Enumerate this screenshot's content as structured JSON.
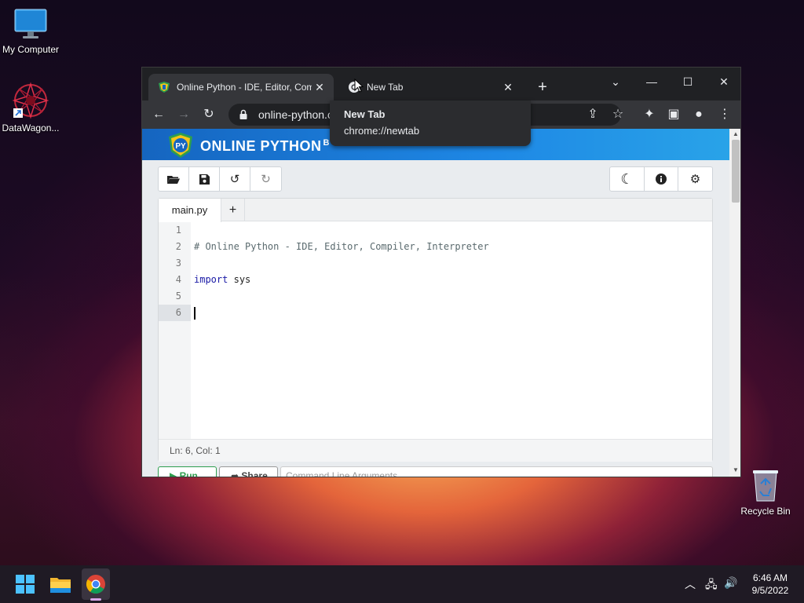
{
  "desktop": {
    "icons": [
      {
        "label": "My Computer"
      },
      {
        "label": "DataWagon..."
      },
      {
        "label": "Recycle Bin"
      }
    ]
  },
  "browser": {
    "tabs": [
      {
        "title": "Online Python - IDE, Editor, Compiler, Interpreter",
        "active": true
      },
      {
        "title": "New Tab",
        "active": false
      }
    ],
    "address": "online-python.com",
    "tooltip": {
      "title": "New Tab",
      "url": "chrome://newtab"
    }
  },
  "site": {
    "title": "ONLINE PYTHON",
    "title_suffix": "B"
  },
  "editor": {
    "file_tabs": [
      {
        "label": "main.py"
      }
    ],
    "add_tab_label": "+",
    "line_numbers": [
      "1",
      "2",
      "3",
      "4",
      "5",
      "6"
    ],
    "comment_line": "# Online Python - IDE, Editor, Compiler, Interpreter",
    "import_keyword": "import",
    "import_module": "sys",
    "status": "Ln: 6,  Col: 1"
  },
  "actions": {
    "run_label": "Run",
    "share_label": "Share",
    "args_placeholder": "Command Line Arguments"
  },
  "taskbar": {
    "time": "6:46 AM",
    "date": "9/5/2022"
  },
  "colors": {
    "accent": "#1e88e5",
    "run": "#2e9e4e",
    "keyword": "#1a1aa6"
  }
}
